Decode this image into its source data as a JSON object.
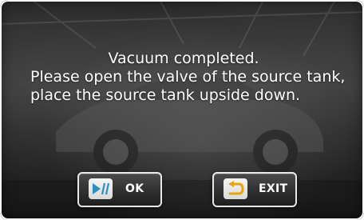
{
  "dialog": {
    "title": "Vacuum completed.",
    "body": "Please open the valve of the source tank, place the source tank upside down."
  },
  "buttons": {
    "ok": {
      "label": "OK",
      "icon": "play-pause-icon",
      "icon_color": "#2c8fc0"
    },
    "exit": {
      "label": "EXIT",
      "icon": "return-arrow-icon",
      "icon_color": "#e7a313"
    }
  }
}
